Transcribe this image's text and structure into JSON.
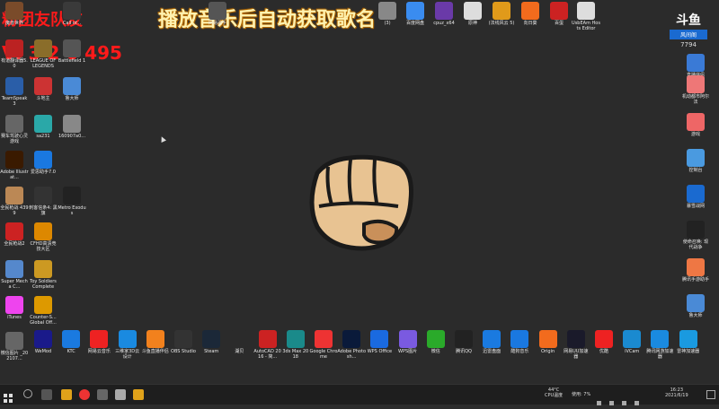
{
  "overlay": {
    "title": "播放音乐后自动获取歌名",
    "red_line1": "粉团友队友",
    "red_line2": "V: 3 2 6 495"
  },
  "logo": {
    "top_text": "斗鱼",
    "bottom_text": "风间阁",
    "number": "7794"
  },
  "desktop_left": [
    {
      "label": "魔兽世界",
      "color": "#7a4b2a"
    },
    {
      "label": "Call of...",
      "color": "#3a3a3a"
    },
    {
      "label": "有道翻译器5.0",
      "color": "#b22"
    },
    {
      "label": "LEAGUE OF LEGENDS",
      "color": "#8a6d2a"
    },
    {
      "label": "Battlefield 1",
      "color": "#555"
    },
    {
      "label": "TeamSpeak 3",
      "color": "#2a5ea8"
    },
    {
      "label": "斗地主",
      "color": "#c33"
    },
    {
      "label": "鲁大师",
      "color": "#4a8ad6"
    },
    {
      "label": "赛车驾驶心灵游戏",
      "color": "#666"
    },
    {
      "label": "sa231",
      "color": "#2aa8a8"
    },
    {
      "label": "160907a0...",
      "color": "#888"
    },
    {
      "label": "Adobe Illustrat...",
      "color": "#3a1a00"
    },
    {
      "label": "爱思助手7.0",
      "color": "#1a78e0"
    },
    {
      "label": "全民枪战 4399",
      "color": "#b85"
    },
    {
      "label": "刺客信条4: 黑旗",
      "color": "#333"
    },
    {
      "label": "Metro Exodus",
      "color": "#222"
    },
    {
      "label": "全民枪战2",
      "color": "#c22"
    },
    {
      "label": "CFHD高清竞技大区",
      "color": "#d80"
    },
    {
      "label": "Super Mecha C...",
      "color": "#58c"
    },
    {
      "label": "Toy Soldiers Complete",
      "color": "#c92"
    },
    {
      "label": "iTunes",
      "color": "#e4e"
    },
    {
      "label": "Counter-S... Global Off...",
      "color": "#d90"
    },
    {
      "label": "微信图片 _202107...",
      "color": "#666"
    }
  ],
  "desktop_top": [
    {
      "label": "网易歌手",
      "color": "#555"
    },
    {
      "label": "(3)",
      "color": "#888"
    },
    {
      "label": "百度网盘",
      "color": "#3a8cf0"
    },
    {
      "label": "cpuz_x64",
      "color": "#6a3aa8"
    },
    {
      "label": "原神",
      "color": "#ddd"
    },
    {
      "label": "(法线风云 5)",
      "color": "#e09a1a"
    },
    {
      "label": "向日葵",
      "color": "#f26b1d"
    },
    {
      "label": "百蛋",
      "color": "#c22"
    },
    {
      "label": "UsbEAm Hosts Editor",
      "color": "#ddd"
    }
  ],
  "desktop_right": [
    {
      "label": "直播伴侣",
      "color": "#3a7ad6"
    },
    {
      "label": "机动都市阿尔法",
      "color": "#e77"
    },
    {
      "label": "游戏",
      "color": "#e66"
    },
    {
      "label": "控制台",
      "color": "#4a9ae0"
    },
    {
      "label": "暴雪战网",
      "color": "#1a6ad0"
    },
    {
      "label": "使命召唤: 现代战争",
      "color": "#222"
    },
    {
      "label": "腾讯手游助手",
      "color": "#e74"
    },
    {
      "label": "鲁大师",
      "color": "#4a8ad6"
    }
  ],
  "desktop_bottom": [
    {
      "label": "WeMod",
      "color": "#1a1a8a"
    },
    {
      "label": "KTC",
      "color": "#1a7ae0"
    },
    {
      "label": "网易云音乐",
      "color": "#e22"
    },
    {
      "label": "三维家3D云设计",
      "color": "#1a8ae0"
    },
    {
      "label": "斗鱼直播伴侣",
      "color": "#f2811d"
    },
    {
      "label": "OBS Studio",
      "color": "#333"
    },
    {
      "label": "Steam",
      "color": "#1b2838"
    },
    {
      "label": "湖贝",
      "color": "#2b2b2b"
    },
    {
      "label": "AutoCAD 2016 - 简...",
      "color": "#c22"
    },
    {
      "label": "3ds Max 2018",
      "color": "#1a8a8a"
    },
    {
      "label": "Google Chrome",
      "color": "#e33"
    },
    {
      "label": "Adobe Photosh...",
      "color": "#0a1a3a"
    },
    {
      "label": "WPS Office",
      "color": "#1a6ae0"
    },
    {
      "label": "WPS图片",
      "color": "#7a5ae0"
    },
    {
      "label": "微信",
      "color": "#2aaa2a"
    },
    {
      "label": "腾讯QQ",
      "color": "#222"
    },
    {
      "label": "迅雷盘面",
      "color": "#1a7ae0"
    },
    {
      "label": "酷狗音乐",
      "color": "#1a78e0"
    },
    {
      "label": "Origin",
      "color": "#f26b1d"
    },
    {
      "label": "网易UU加速器",
      "color": "#1a1a2a"
    },
    {
      "label": "优酷",
      "color": "#e22"
    },
    {
      "label": "iVCam",
      "color": "#1a8ad0"
    },
    {
      "label": "腾讯网游加速器",
      "color": "#1a8ae0"
    },
    {
      "label": "雷神加速器",
      "color": "#1a9ae0"
    }
  ],
  "taskbar": {
    "temp": "44°C",
    "temp_label": "CPU温度",
    "usage": "使用: 7%",
    "clock_time": "16:23",
    "clock_date": "2021/6/19"
  }
}
